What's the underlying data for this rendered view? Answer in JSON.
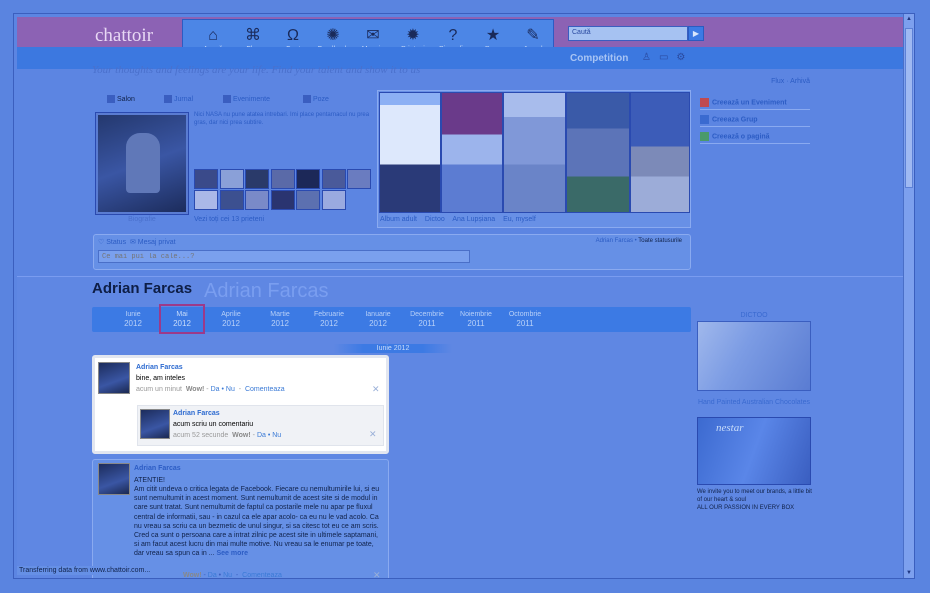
{
  "logo": "chattoir",
  "menu": [
    {
      "label": "Acasă",
      "icon": "home-icon",
      "glyph": "⌂"
    },
    {
      "label": "Flux",
      "icon": "command-icon",
      "glyph": "⌘"
    },
    {
      "label": "Cont",
      "icon": "account-icon",
      "glyph": "Ω"
    },
    {
      "label": "Feedback",
      "icon": "feedback-icon",
      "glyph": "✺"
    },
    {
      "label": "Mesaje",
      "icon": "envelope-icon",
      "glyph": "✉"
    },
    {
      "label": "Prieteni",
      "icon": "friends-icon",
      "glyph": "✹"
    },
    {
      "label": "Biografie",
      "icon": "question-icon",
      "glyph": "?"
    },
    {
      "label": "Poze",
      "icon": "star-icon",
      "glyph": "★"
    },
    {
      "label": "Jurnal",
      "icon": "pen-icon",
      "glyph": "✎"
    }
  ],
  "search": {
    "placeholder": "Caută",
    "button": "▶"
  },
  "competition": "Competition",
  "slogan": "Your thoughts and feelings are your life. Find your talent and show it to us",
  "top_links": {
    "flux": "Flux",
    "arhiva": "Arhivă"
  },
  "profile_tabs": [
    "Salon",
    "Jurnal",
    "Evenimente",
    "Poze"
  ],
  "bio_label": "Biografie",
  "nasa_text": "Nici NASA nu pune atatea intrebari. Imi place pentarnacul nu prea gras, dar nici prea subtire.",
  "friends_link": "Vezi toți cei 13 prieteni",
  "albums": [
    "Album adult",
    "Dictoo",
    "Ana Lupșiana",
    "Eu, myself"
  ],
  "actions": [
    "Creează un Eveniment",
    "Creeaza Grup",
    "Creează o pagină"
  ],
  "status": {
    "tab1": "Status",
    "tab2": "Mesaj privat",
    "placeholder": "Ce mai pui la cale...?",
    "owner": "Adrian Farcas",
    "all": "Toate statusurile"
  },
  "profile_name": "Adrian Farcas",
  "ghost_name": "Adrian Farcas",
  "months": [
    {
      "m": "Iunie",
      "y": "2012"
    },
    {
      "m": "Mai",
      "y": "2012"
    },
    {
      "m": "Aprilie",
      "y": "2012"
    },
    {
      "m": "Martie",
      "y": "2012"
    },
    {
      "m": "Februarie",
      "y": "2012"
    },
    {
      "m": "Ianuarie",
      "y": "2012"
    },
    {
      "m": "Decembrie",
      "y": "2011"
    },
    {
      "m": "Noiembrie",
      "y": "2011"
    },
    {
      "m": "Octombrie",
      "y": "2011"
    }
  ],
  "current_month": "Iunie 2012",
  "post1": {
    "author": "Adrian Farcas",
    "text": "bine, am inteles",
    "time": "acum un minut",
    "wow": "Wow!",
    "da": "Da",
    "nu": "Nu",
    "comment": "Comenteaza"
  },
  "comment1": {
    "author": "Adrian Farcas",
    "text": "acum scriu un comentariu",
    "time": "acum 52 secunde",
    "wow": "Wow!",
    "da": "Da",
    "nu": "Nu"
  },
  "post2": {
    "author": "Adrian Farcas",
    "title": "ATENTIE!",
    "body": "Am citit undeva o critica legata de Facebook. Fiecare cu nemultumirile lui, si eu sunt nemultumit in acest moment. Sunt nemultumit de acest site si de modul in care sunt tratat. Sunt nemultumit de faptul ca postarile mele nu apar pe fluxul central de informatii, sau - in cazul ca ele apar acolo- ca eu nu le vad acolo. Ca nu vreau sa scriu ca un bezmetic de unul singur, si sa citesc tot eu ce am scris. Cred ca sunt o persoana care a intrat zilnic pe acest site in ultimele saptamani, si am facut acest lucru din mai multe motive. Nu vreau sa le enumar pe toate, dar vreau sa spun ca in ...",
    "see_more": "See more",
    "wow": "Wow!",
    "da": "Da",
    "nu": "Nu",
    "comment": "Comenteaza"
  },
  "side": {
    "dictoo": "DICTOO",
    "ad_title": "Hand Painted Australian Chocolates",
    "ad_brand": "nestar",
    "ad_text": "We invite you to meet our brands, a little bit of our heart & soul",
    "ad_text2": "ALL OUR PASSION IN EVERY BOX"
  },
  "browser_status": "Transferring data from www.chattoir.com..."
}
